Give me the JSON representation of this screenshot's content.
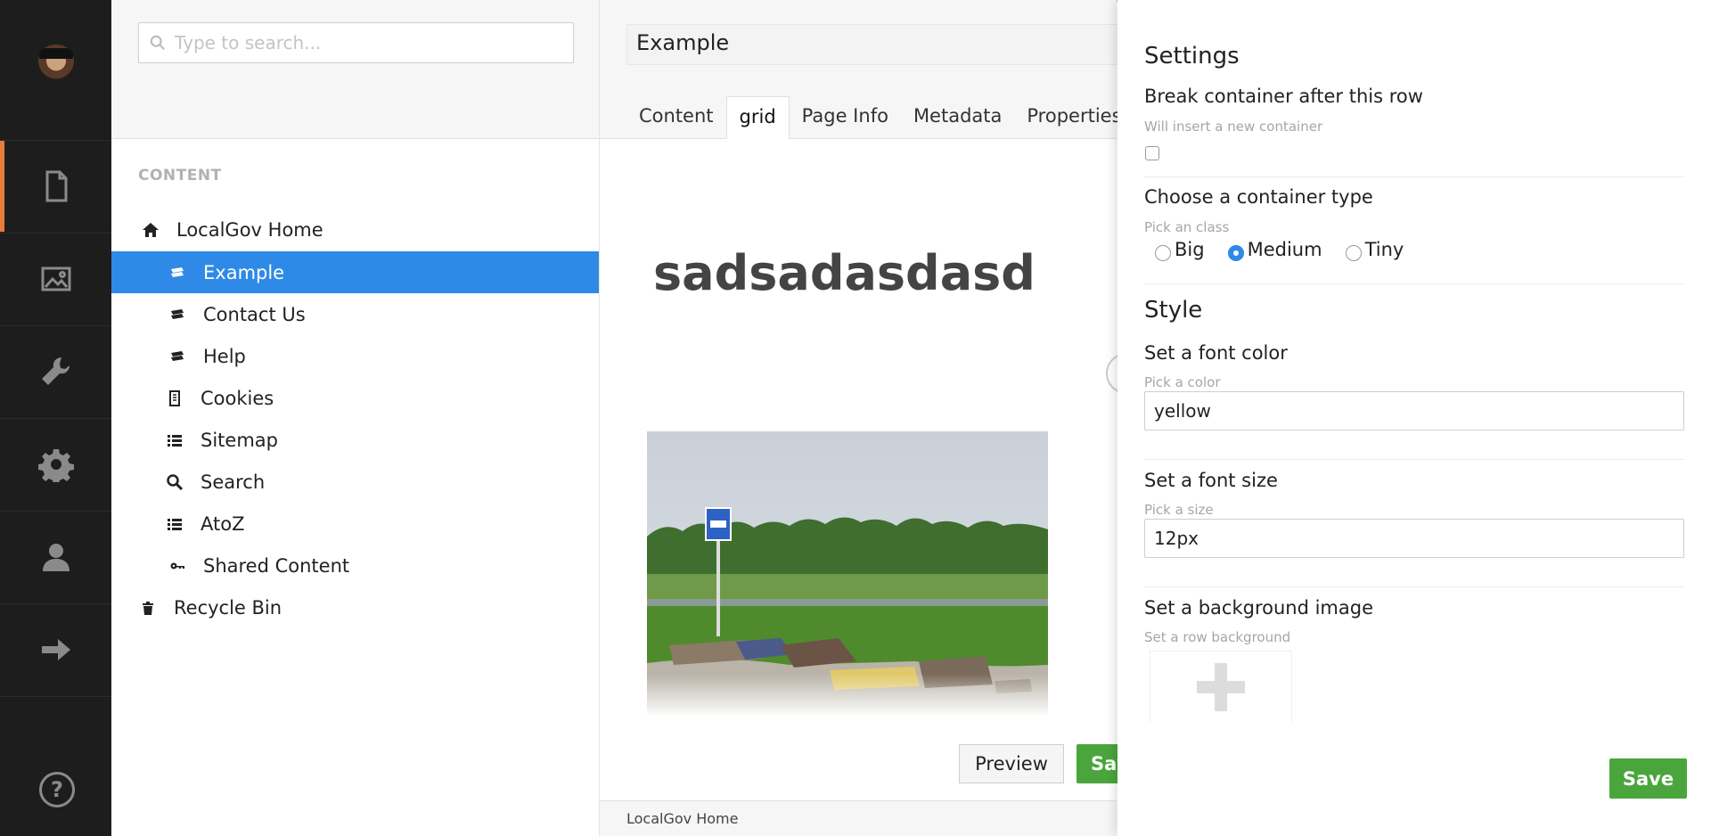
{
  "app": {
    "sections": [
      "content",
      "media",
      "developer",
      "settings",
      "users",
      "forms"
    ],
    "active_section": "content"
  },
  "tree": {
    "search_placeholder": "Type to search...",
    "heading": "CONTENT",
    "nodes": [
      {
        "label": "LocalGov Home",
        "icon": "home-icon",
        "level": 0
      },
      {
        "label": "Example",
        "icon": "document-icon",
        "level": 1,
        "selected": true
      },
      {
        "label": "Contact Us",
        "icon": "document-icon",
        "level": 1
      },
      {
        "label": "Help",
        "icon": "document-icon",
        "level": 1
      },
      {
        "label": "Cookies",
        "icon": "page-icon",
        "level": 1
      },
      {
        "label": "Sitemap",
        "icon": "list-icon",
        "level": 1
      },
      {
        "label": "Search",
        "icon": "search-icon",
        "level": 1
      },
      {
        "label": "AtoZ",
        "icon": "list-icon",
        "level": 1
      },
      {
        "label": "Shared Content",
        "icon": "keys-icon",
        "level": 1
      },
      {
        "label": "Recycle Bin",
        "icon": "trash-icon",
        "level": 0
      }
    ]
  },
  "editor": {
    "title": "Example",
    "tabs": [
      "Content",
      "grid",
      "Page Info",
      "Metadata",
      "Properties"
    ],
    "active_tab": "grid",
    "heading_text": "sadsadasdasd",
    "preview_label": "Preview",
    "save_label": "Save",
    "footer_breadcrumb": "LocalGov Home"
  },
  "settings": {
    "title": "Settings",
    "break_label": "Break container after this row",
    "break_hint": "Will insert a new container",
    "break_checked": false,
    "container_label": "Choose a container type",
    "container_hint": "Pick an class",
    "container_options": [
      "Big",
      "Medium",
      "Tiny"
    ],
    "container_selected": "Medium",
    "style_title": "Style",
    "font_color_label": "Set a font color",
    "font_color_hint": "Pick a color",
    "font_color_value": "yellow",
    "font_size_label": "Set a font size",
    "font_size_hint": "Pick a size",
    "font_size_value": "12px",
    "bg_label": "Set a background image",
    "bg_hint": "Set a row background",
    "save_label": "Save"
  },
  "colors": {
    "accent": "#2e8ae6",
    "save_green": "#4aa63c",
    "active_marker": "#e77d3c",
    "sidebar_bg": "#1d1d1d"
  }
}
